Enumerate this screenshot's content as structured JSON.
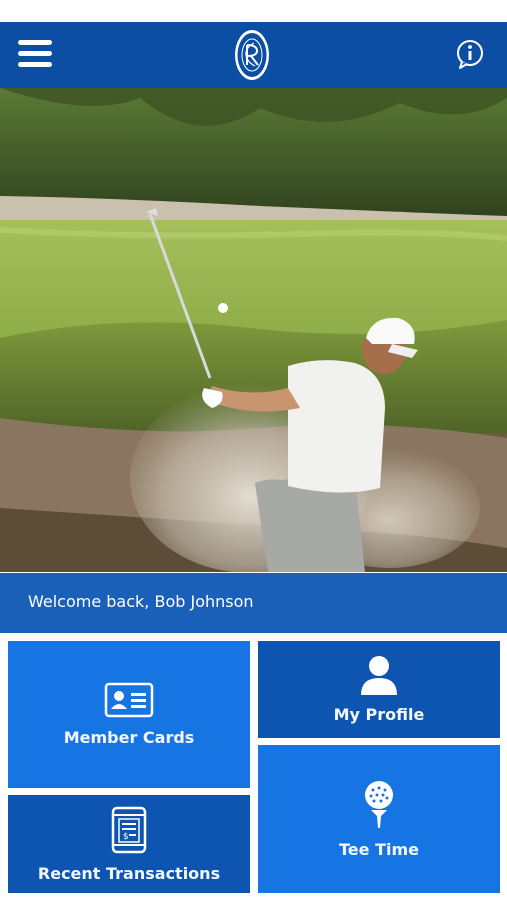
{
  "header": {
    "menu_icon": "hamburger-menu-icon",
    "logo": "club-crest-logo",
    "info_icon": "info-speech-bubble-icon",
    "background": "#0c4ea4"
  },
  "hero": {
    "image": "golfer-bunker-shot-photo"
  },
  "welcome": {
    "text": "Welcome back, Bob Johnson"
  },
  "tiles": {
    "member_cards": {
      "label": "Member Cards",
      "icon": "id-card-icon"
    },
    "my_profile": {
      "label": "My Profile",
      "icon": "person-icon"
    },
    "recent_transactions": {
      "label": "Recent Transactions",
      "icon": "phone-receipt-icon"
    },
    "tee_time": {
      "label": "Tee Time",
      "icon": "golf-ball-tee-icon"
    }
  },
  "colors": {
    "tile_bright": "#1774e3",
    "tile_dark": "#0d55b0",
    "welcome_bar": "#1a5fb8"
  }
}
